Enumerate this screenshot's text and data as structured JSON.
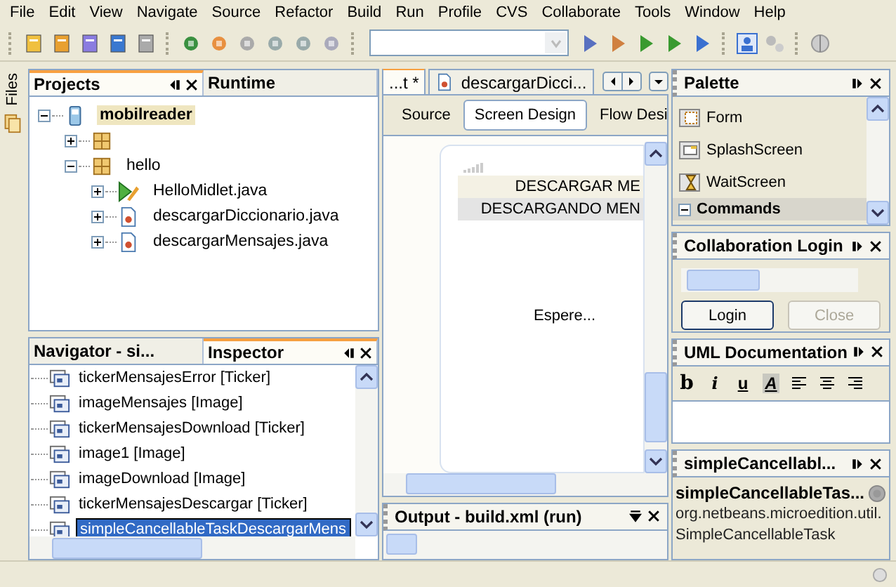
{
  "menu": [
    "File",
    "Edit",
    "View",
    "Navigate",
    "Source",
    "Refactor",
    "Build",
    "Run",
    "Profile",
    "CVS",
    "Collaborate",
    "Tools",
    "Window",
    "Help"
  ],
  "side_strip": {
    "label": "Files"
  },
  "projects": {
    "tabs": [
      {
        "label": "Projects",
        "selected": true
      },
      {
        "label": "Runtime",
        "selected": false
      }
    ],
    "tree": [
      {
        "label": "mobilreader",
        "kind": "project",
        "expanded": true,
        "selected": true,
        "children": [
          {
            "kind": "package",
            "expanded": false,
            "selected": false
          },
          {
            "label": "hello",
            "kind": "package",
            "expanded": true,
            "selected": false,
            "children": [
              {
                "label": "HelloMidlet.java",
                "kind": "midlet",
                "expanded": false,
                "selected": false
              },
              {
                "label": "descargarDiccionario.java",
                "kind": "class",
                "expanded": false,
                "selected": false
              },
              {
                "label": "descargarMensajes.java",
                "kind": "class",
                "expanded": false,
                "selected": false
              }
            ]
          }
        ]
      }
    ]
  },
  "inspector": {
    "tabs": [
      {
        "label": "Navigator - si...",
        "selected": false
      },
      {
        "label": "Inspector",
        "selected": true
      }
    ],
    "items": [
      {
        "label": "tickerMensajesError [Ticker]",
        "selected": false
      },
      {
        "label": "imageMensajes [Image]",
        "selected": false
      },
      {
        "label": "tickerMensajesDownload [Ticker]",
        "selected": false
      },
      {
        "label": "image1 [Image]",
        "selected": false
      },
      {
        "label": "imageDownload [Image]",
        "selected": false
      },
      {
        "label": "tickerMensajesDescargar [Ticker]",
        "selected": false
      },
      {
        "label": "simpleCancellableTaskDescargarMens",
        "selected": true
      }
    ]
  },
  "editor": {
    "tabs": [
      {
        "label": "...t *",
        "selected": true
      },
      {
        "label": "descargarDicci...",
        "selected": false
      }
    ],
    "views": [
      {
        "label": "Source",
        "selected": false
      },
      {
        "label": "Screen Design",
        "selected": true
      },
      {
        "label": "Flow Desi",
        "selected": false
      }
    ],
    "device": {
      "lines": [
        {
          "text": "DESCARGAR ME",
          "kind": "title"
        },
        {
          "text": "DESCARGANDO MEN",
          "kind": "ticker"
        }
      ],
      "body": "Espere..."
    }
  },
  "output": {
    "title": "Output - build.xml (run)"
  },
  "palette": {
    "title": "Palette",
    "items": [
      {
        "label": "Form",
        "kind": "form"
      },
      {
        "label": "SplashScreen",
        "kind": "splash"
      },
      {
        "label": "WaitScreen",
        "kind": "wait"
      },
      {
        "label": "Commands",
        "kind": "category",
        "expanded": true
      }
    ]
  },
  "collab": {
    "title": "Collaboration Login",
    "buttons": [
      {
        "label": "Login",
        "disabled": false
      },
      {
        "label": "Close",
        "disabled": true
      }
    ]
  },
  "uml": {
    "title": "UML Documentation",
    "format_buttons": [
      {
        "label": "b",
        "selected": false
      },
      {
        "label": "i",
        "selected": false
      },
      {
        "label": "u",
        "selected": false
      },
      {
        "label": "A",
        "selected": true
      }
    ]
  },
  "properties": {
    "title": "simpleCancellabl...",
    "name": "simpleCancellableTas...",
    "description": "org.netbeans.microedition.util.SimpleCancellableTask"
  }
}
